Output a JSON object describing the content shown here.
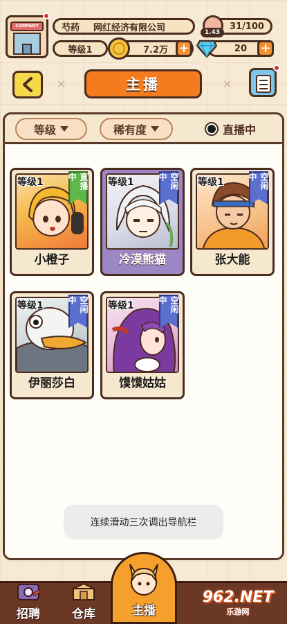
{
  "top": {
    "company_sign": "COMPANY",
    "owner": "芍药",
    "company": "网红经济有限公司",
    "level": "等级1",
    "money": "7.2万",
    "fans_level": "1.43",
    "fans": "31/100",
    "gems": "20",
    "plus": "+"
  },
  "header": {
    "title": "主播"
  },
  "filters": {
    "level": "等级",
    "rarity": "稀有度",
    "live_label": "直播中"
  },
  "cards": [
    {
      "name": "小橙子",
      "level": "等级1",
      "status": "直播中",
      "status_type": "live",
      "selected": false
    },
    {
      "name": "冷漠熊猫",
      "level": "等级1",
      "status": "空闲中",
      "status_type": "idle",
      "selected": true
    },
    {
      "name": "张大能",
      "level": "等级1",
      "status": "空闲中",
      "status_type": "idle",
      "selected": false
    },
    {
      "name": "伊丽莎白",
      "level": "等级1",
      "status": "空闲中",
      "status_type": "idle",
      "selected": false
    },
    {
      "name": "馍馍姑姑",
      "level": "等级1",
      "status": "空闲中",
      "status_type": "idle",
      "selected": false
    }
  ],
  "toast": "连续滑动三次调出导航栏",
  "nav": {
    "recruit": "招聘",
    "warehouse": "仓库",
    "anchor": "主播"
  },
  "watermark": {
    "brand": "962.NET",
    "sub": "乐游网"
  },
  "colors": {
    "accent_orange": "#f47c1f",
    "live_green": "#5fb64a",
    "idle_blue": "#5b6fcf",
    "selected_purple": "#9c86c4",
    "outline_brown": "#4a2c20"
  }
}
